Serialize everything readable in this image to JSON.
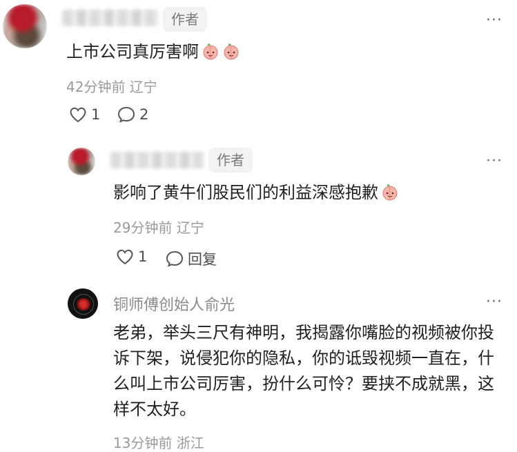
{
  "comments": [
    {
      "username": "",
      "author_badge": "作者",
      "text": "上市公司真厉害啊",
      "emoji_count": 2,
      "time": "42分钟前",
      "location": "辽宁",
      "likes": "1",
      "replies": "2"
    },
    {
      "username": "",
      "author_badge": "作者",
      "text": "影响了黄牛们股民们的利益深感抱歉",
      "emoji_count": 1,
      "time": "29分钟前",
      "location": "辽宁",
      "likes": "1",
      "reply_label": "回复"
    },
    {
      "username": "铜师傅创始人俞光",
      "text": "老弟，举头三尺有神明，我揭露你嘴脸的视频被你投诉下架，说侵犯你的隐私，你的诋毁视频一直在，什么叫上市公司厉害，扮什么可怜？要挟不成就黑，这样不太好。",
      "time": "13分钟前",
      "location": "浙江"
    }
  ],
  "more_label": "···",
  "emoji_icon": "peach-face-emoji",
  "colors": {
    "text": "#1f1f1f",
    "muted": "#9a9a9a",
    "badge_bg": "#f2f2f2",
    "emoji_pink": "#f6b3a8"
  }
}
